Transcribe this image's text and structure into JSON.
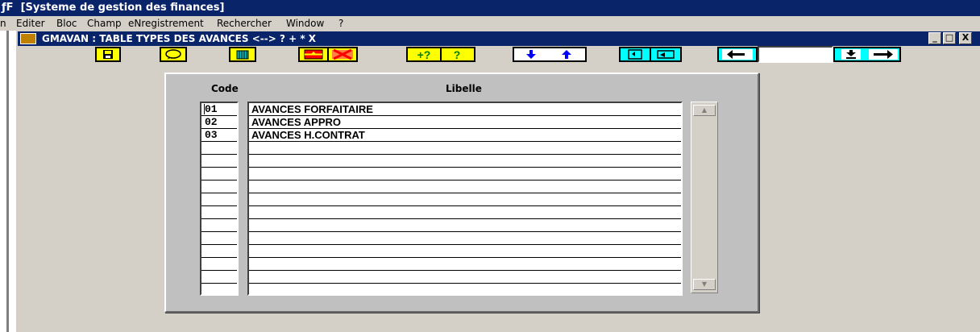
{
  "app": {
    "title": "ƒF  [Systeme de gestion des finances]"
  },
  "menu": [
    "n",
    "Editer",
    "Bloc",
    "Champ",
    "eNregistrement",
    "Rechercher",
    "Window",
    "?"
  ],
  "window": {
    "title": "GMAVAN : TABLE TYPES DES AVANCES <--> ? + * X",
    "controls": {
      "minimize": "_",
      "maximize": "□",
      "close": "X"
    }
  },
  "toolbar": {
    "buttons": [
      {
        "name": "save-button",
        "icon": "floppy-icon"
      },
      {
        "name": "exit-button",
        "icon": "speech-icon"
      },
      {
        "name": "list-button",
        "icon": "grid-icon"
      },
      {
        "name": "insert-record-button",
        "icon": "insert-icon"
      },
      {
        "name": "delete-record-button",
        "icon": "delete-icon"
      },
      {
        "name": "query-enter-button",
        "icon": "query-enter-icon"
      },
      {
        "name": "query-execute-button",
        "icon": "question-icon"
      },
      {
        "name": "next-record-button",
        "icon": "arrow-down-icon"
      },
      {
        "name": "previous-record-button",
        "icon": "arrow-up-icon"
      },
      {
        "name": "refresh-button",
        "icon": "refresh-icon"
      },
      {
        "name": "print-button",
        "icon": "print-icon"
      },
      {
        "name": "previous-block-button",
        "icon": "arrow-left-icon"
      },
      {
        "name": "last-record-button",
        "icon": "arrow-bottom-icon"
      },
      {
        "name": "next-block-button",
        "icon": "arrow-right-icon"
      }
    ],
    "nav_value": ""
  },
  "table": {
    "headers": {
      "code": "Code",
      "libelle": "Libelle"
    },
    "rows": [
      {
        "code": "01",
        "libelle": "AVANCES FORFAITAIRE"
      },
      {
        "code": "02",
        "libelle": "AVANCES APPRO"
      },
      {
        "code": "03",
        "libelle": "AVANCES H.CONTRAT"
      },
      {
        "code": "",
        "libelle": ""
      },
      {
        "code": "",
        "libelle": ""
      },
      {
        "code": "",
        "libelle": ""
      },
      {
        "code": "",
        "libelle": ""
      },
      {
        "code": "",
        "libelle": ""
      },
      {
        "code": "",
        "libelle": ""
      },
      {
        "code": "",
        "libelle": ""
      },
      {
        "code": "",
        "libelle": ""
      },
      {
        "code": "",
        "libelle": ""
      },
      {
        "code": "",
        "libelle": ""
      },
      {
        "code": "",
        "libelle": ""
      },
      {
        "code": "",
        "libelle": ""
      }
    ]
  },
  "colors": {
    "title_bar": "#0a246a",
    "window_bg": "#d4d0c8",
    "button_yellow": "#ffff00",
    "button_cyan": "#00ffff",
    "button_blue": "#0000ff"
  }
}
